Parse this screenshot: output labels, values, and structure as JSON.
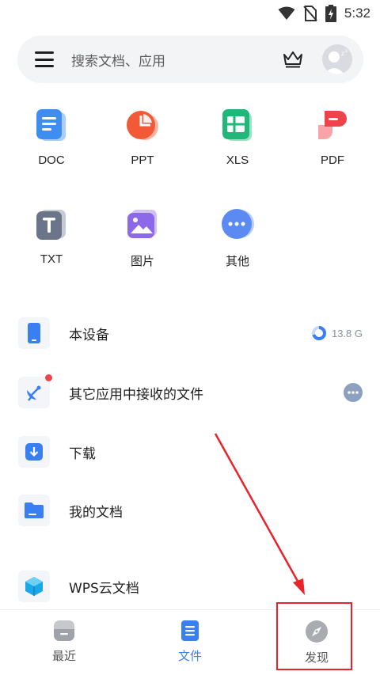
{
  "status_bar": {
    "time": "5:32",
    "icons": [
      "wifi-icon",
      "no-sim-icon",
      "battery-charging-icon"
    ]
  },
  "search": {
    "placeholder": "搜索文档、应用",
    "icons": [
      "menu-icon",
      "crown-icon",
      "avatar"
    ]
  },
  "file_types": [
    {
      "label": "DOC",
      "icon": "doc-icon",
      "color": "#3d8ef0"
    },
    {
      "label": "PPT",
      "icon": "ppt-icon",
      "color": "#f25a37"
    },
    {
      "label": "XLS",
      "icon": "xls-icon",
      "color": "#1fb87a"
    },
    {
      "label": "PDF",
      "icon": "pdf-icon",
      "color": "#f0424a"
    },
    {
      "label": "TXT",
      "icon": "txt-icon",
      "color": "#6b7489"
    },
    {
      "label": "图片",
      "icon": "image-icon",
      "color": "#8c69e8"
    },
    {
      "label": "其他",
      "icon": "more-icon",
      "color": "#5b8af2"
    }
  ],
  "locations": [
    {
      "label": "本设备",
      "icon": "phone-icon",
      "extra": "13.8 G"
    },
    {
      "label": "其它应用中接收的文件",
      "icon": "satellite-icon"
    },
    {
      "label": "下载",
      "icon": "download-icon"
    },
    {
      "label": "我的文档",
      "icon": "folder-icon"
    },
    {
      "label": "WPS云文档",
      "icon": "cloud-cube-icon"
    }
  ],
  "storage": {
    "used_fraction": 0.7
  },
  "bottom_nav": [
    {
      "label": "最近",
      "icon": "recent-icon",
      "active": false
    },
    {
      "label": "文件",
      "icon": "files-icon",
      "active": true
    },
    {
      "label": "发现",
      "icon": "compass-icon",
      "active": false
    }
  ],
  "colors": {
    "accent": "#3a7ff2",
    "inactive": "#555555",
    "annotation": "#e8232a"
  }
}
